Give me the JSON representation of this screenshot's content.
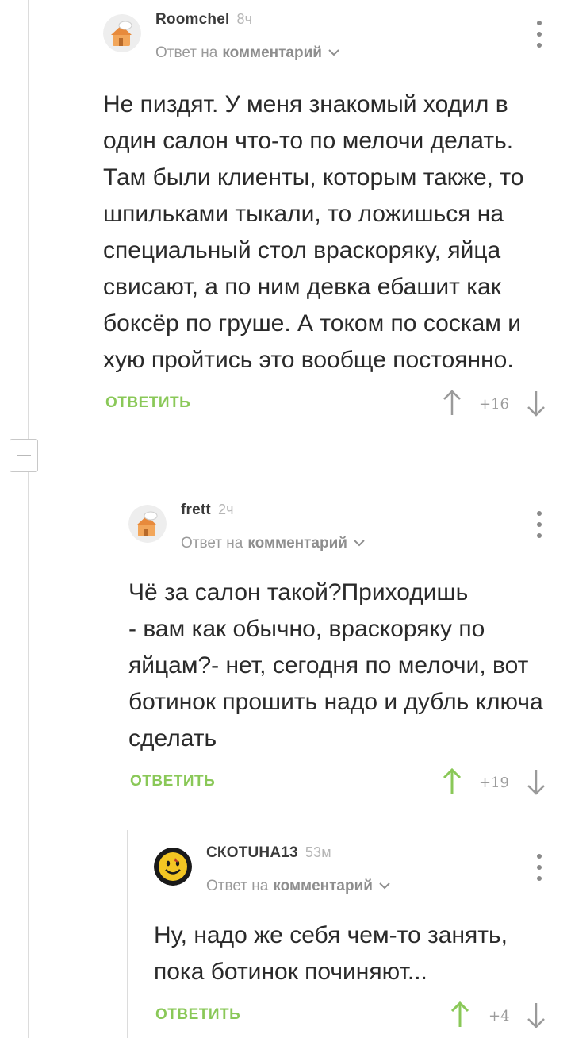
{
  "comments": [
    {
      "author": "Roomchel",
      "time": "8ч",
      "reply_prefix": "Ответ на",
      "reply_target": "комментарий",
      "text": "Не пиздят. У меня знакомый ходил в один салон что-то по мелочи делать. Там были клиенты, которым также, то шпильками тыкали, то ложишься на специальный стол враскоряку, яйца свисают, а по ним девка ебашит как боксёр по груше. А током по соскам и хую пройтись это вообще постоянно.",
      "reply_label": "ОТВЕТИТЬ",
      "rating": "+16",
      "upvote_state": "neutral"
    },
    {
      "author": "frett",
      "time": "2ч",
      "reply_prefix": "Ответ на",
      "reply_target": "комментарий",
      "text": "Чё за салон такой?Приходишь\n- вам как обычно, враскоряку по яйцам?- нет, сегодня по мелочи, вот ботинок прошить надо и дубль ключа сделать",
      "reply_label": "ОТВЕТИТЬ",
      "rating": "+19",
      "upvote_state": "active"
    },
    {
      "author": "СКОТUНА13",
      "time": "53м",
      "reply_prefix": "Ответ на",
      "reply_target": "комментарий",
      "text": "Ну, надо же себя чем-то занять, пока ботинок починяют...",
      "reply_label": "ОТВЕТИТЬ",
      "rating": "+4",
      "upvote_state": "active"
    }
  ],
  "icons": {
    "menu": "kebab-menu-icon",
    "up": "arrow-up-icon",
    "down": "arrow-down-icon",
    "collapse": "minus-icon",
    "chevron": "chevron-down-icon"
  },
  "colors": {
    "accent": "#8ac858",
    "muted": "#9a9a9a",
    "text": "#2a2a2a",
    "thread_line": "#dcdcdc"
  }
}
